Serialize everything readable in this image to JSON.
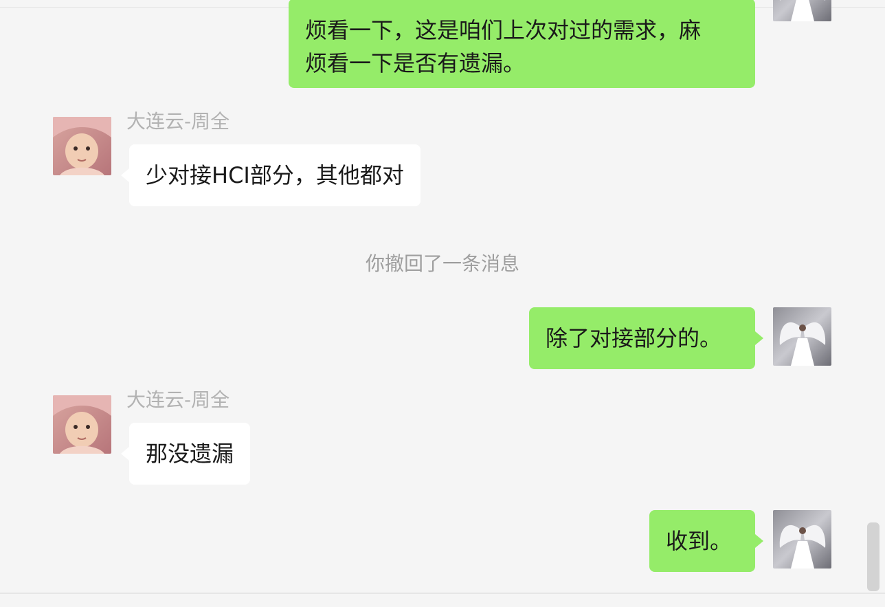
{
  "colors": {
    "sent_bubble": "#95ec69",
    "received_bubble": "#ffffff",
    "background": "#f5f5f5",
    "sender_name": "#b2b2b2",
    "system_text": "#9e9e9e"
  },
  "messages": [
    {
      "side": "right",
      "lines": [
        "烦看一下，这是咱们上次对过的需求，麻",
        "烦看一下是否有遗漏。"
      ],
      "avatar": "angel-avatar"
    },
    {
      "side": "left",
      "sender": "大连云-周全",
      "text": "少对接HCI部分，其他都对",
      "avatar": "child-avatar"
    },
    {
      "side": "system",
      "text": "你撤回了一条消息"
    },
    {
      "side": "right",
      "text": "除了对接部分的。",
      "avatar": "angel-avatar"
    },
    {
      "side": "left",
      "sender": "大连云-周全",
      "text": "那没遗漏",
      "avatar": "child-avatar"
    },
    {
      "side": "right",
      "text": "收到。",
      "avatar": "angel-avatar"
    }
  ]
}
